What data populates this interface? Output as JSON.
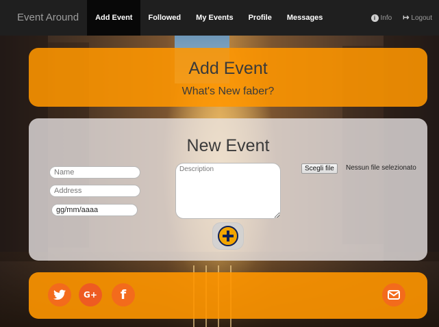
{
  "navbar": {
    "brand": "Event Around",
    "items": [
      {
        "label": "Add Event",
        "active": true
      },
      {
        "label": "Followed",
        "active": false
      },
      {
        "label": "My Events",
        "active": false
      },
      {
        "label": "Profile",
        "active": false
      },
      {
        "label": "Messages",
        "active": false
      }
    ],
    "right": {
      "info_label": "Info",
      "info_icon": "info-circle-icon",
      "logout_label": "Logout",
      "logout_icon": "logout-icon"
    }
  },
  "header_panel": {
    "title": "Add Event",
    "subtitle": "What's New faber?"
  },
  "form_panel": {
    "title": "New Event",
    "name_placeholder": "Name",
    "address_placeholder": "Address",
    "date_value": "gg/mm/aaaa",
    "description_placeholder": "Description",
    "file_button_label": "Scegli file",
    "file_status": "Nessun file selezionato",
    "add_icon": "plus-circle-icon"
  },
  "footer_panel": {
    "social": [
      {
        "name": "twitter-icon"
      },
      {
        "name": "google-plus-icon",
        "label": "G+"
      },
      {
        "name": "facebook-icon",
        "label": "f"
      }
    ],
    "mail_icon": "envelope-icon"
  },
  "colors": {
    "navbar_bg": "#1f1f1f",
    "accent_orange": "#ff9600",
    "social_orange": "#f36b1c",
    "plus_fill": "#f3a500",
    "plus_stroke": "#0f1f55"
  }
}
